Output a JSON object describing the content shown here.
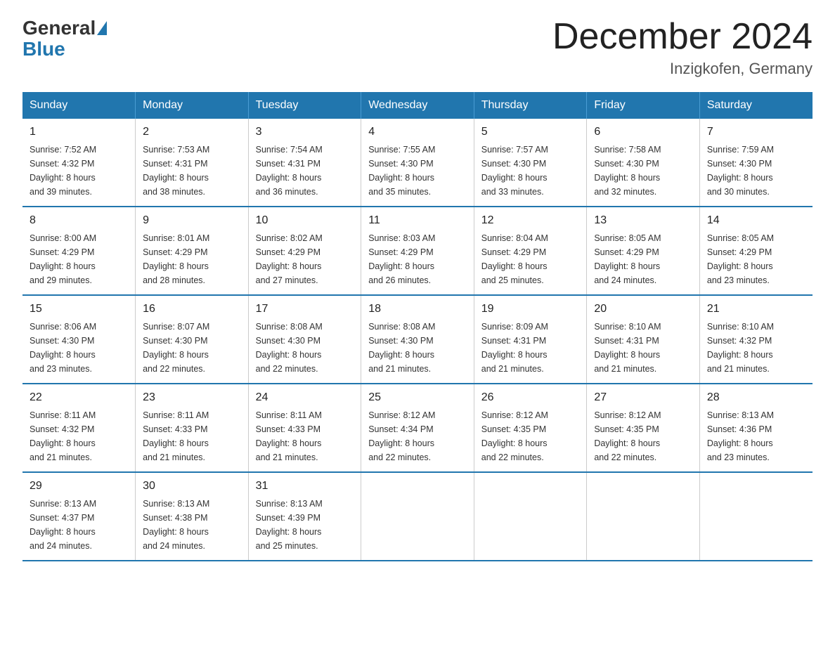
{
  "header": {
    "logo_general": "General",
    "logo_blue": "Blue",
    "month_title": "December 2024",
    "location": "Inzigkofen, Germany"
  },
  "weekdays": [
    "Sunday",
    "Monday",
    "Tuesday",
    "Wednesday",
    "Thursday",
    "Friday",
    "Saturday"
  ],
  "weeks": [
    [
      {
        "day": "1",
        "sunrise": "7:52 AM",
        "sunset": "4:32 PM",
        "daylight": "8 hours and 39 minutes."
      },
      {
        "day": "2",
        "sunrise": "7:53 AM",
        "sunset": "4:31 PM",
        "daylight": "8 hours and 38 minutes."
      },
      {
        "day": "3",
        "sunrise": "7:54 AM",
        "sunset": "4:31 PM",
        "daylight": "8 hours and 36 minutes."
      },
      {
        "day": "4",
        "sunrise": "7:55 AM",
        "sunset": "4:30 PM",
        "daylight": "8 hours and 35 minutes."
      },
      {
        "day": "5",
        "sunrise": "7:57 AM",
        "sunset": "4:30 PM",
        "daylight": "8 hours and 33 minutes."
      },
      {
        "day": "6",
        "sunrise": "7:58 AM",
        "sunset": "4:30 PM",
        "daylight": "8 hours and 32 minutes."
      },
      {
        "day": "7",
        "sunrise": "7:59 AM",
        "sunset": "4:30 PM",
        "daylight": "8 hours and 30 minutes."
      }
    ],
    [
      {
        "day": "8",
        "sunrise": "8:00 AM",
        "sunset": "4:29 PM",
        "daylight": "8 hours and 29 minutes."
      },
      {
        "day": "9",
        "sunrise": "8:01 AM",
        "sunset": "4:29 PM",
        "daylight": "8 hours and 28 minutes."
      },
      {
        "day": "10",
        "sunrise": "8:02 AM",
        "sunset": "4:29 PM",
        "daylight": "8 hours and 27 minutes."
      },
      {
        "day": "11",
        "sunrise": "8:03 AM",
        "sunset": "4:29 PM",
        "daylight": "8 hours and 26 minutes."
      },
      {
        "day": "12",
        "sunrise": "8:04 AM",
        "sunset": "4:29 PM",
        "daylight": "8 hours and 25 minutes."
      },
      {
        "day": "13",
        "sunrise": "8:05 AM",
        "sunset": "4:29 PM",
        "daylight": "8 hours and 24 minutes."
      },
      {
        "day": "14",
        "sunrise": "8:05 AM",
        "sunset": "4:29 PM",
        "daylight": "8 hours and 23 minutes."
      }
    ],
    [
      {
        "day": "15",
        "sunrise": "8:06 AM",
        "sunset": "4:30 PM",
        "daylight": "8 hours and 23 minutes."
      },
      {
        "day": "16",
        "sunrise": "8:07 AM",
        "sunset": "4:30 PM",
        "daylight": "8 hours and 22 minutes."
      },
      {
        "day": "17",
        "sunrise": "8:08 AM",
        "sunset": "4:30 PM",
        "daylight": "8 hours and 22 minutes."
      },
      {
        "day": "18",
        "sunrise": "8:08 AM",
        "sunset": "4:30 PM",
        "daylight": "8 hours and 21 minutes."
      },
      {
        "day": "19",
        "sunrise": "8:09 AM",
        "sunset": "4:31 PM",
        "daylight": "8 hours and 21 minutes."
      },
      {
        "day": "20",
        "sunrise": "8:10 AM",
        "sunset": "4:31 PM",
        "daylight": "8 hours and 21 minutes."
      },
      {
        "day": "21",
        "sunrise": "8:10 AM",
        "sunset": "4:32 PM",
        "daylight": "8 hours and 21 minutes."
      }
    ],
    [
      {
        "day": "22",
        "sunrise": "8:11 AM",
        "sunset": "4:32 PM",
        "daylight": "8 hours and 21 minutes."
      },
      {
        "day": "23",
        "sunrise": "8:11 AM",
        "sunset": "4:33 PM",
        "daylight": "8 hours and 21 minutes."
      },
      {
        "day": "24",
        "sunrise": "8:11 AM",
        "sunset": "4:33 PM",
        "daylight": "8 hours and 21 minutes."
      },
      {
        "day": "25",
        "sunrise": "8:12 AM",
        "sunset": "4:34 PM",
        "daylight": "8 hours and 22 minutes."
      },
      {
        "day": "26",
        "sunrise": "8:12 AM",
        "sunset": "4:35 PM",
        "daylight": "8 hours and 22 minutes."
      },
      {
        "day": "27",
        "sunrise": "8:12 AM",
        "sunset": "4:35 PM",
        "daylight": "8 hours and 22 minutes."
      },
      {
        "day": "28",
        "sunrise": "8:13 AM",
        "sunset": "4:36 PM",
        "daylight": "8 hours and 23 minutes."
      }
    ],
    [
      {
        "day": "29",
        "sunrise": "8:13 AM",
        "sunset": "4:37 PM",
        "daylight": "8 hours and 24 minutes."
      },
      {
        "day": "30",
        "sunrise": "8:13 AM",
        "sunset": "4:38 PM",
        "daylight": "8 hours and 24 minutes."
      },
      {
        "day": "31",
        "sunrise": "8:13 AM",
        "sunset": "4:39 PM",
        "daylight": "8 hours and 25 minutes."
      },
      null,
      null,
      null,
      null
    ]
  ],
  "labels": {
    "sunrise": "Sunrise:",
    "sunset": "Sunset:",
    "daylight": "Daylight:"
  }
}
